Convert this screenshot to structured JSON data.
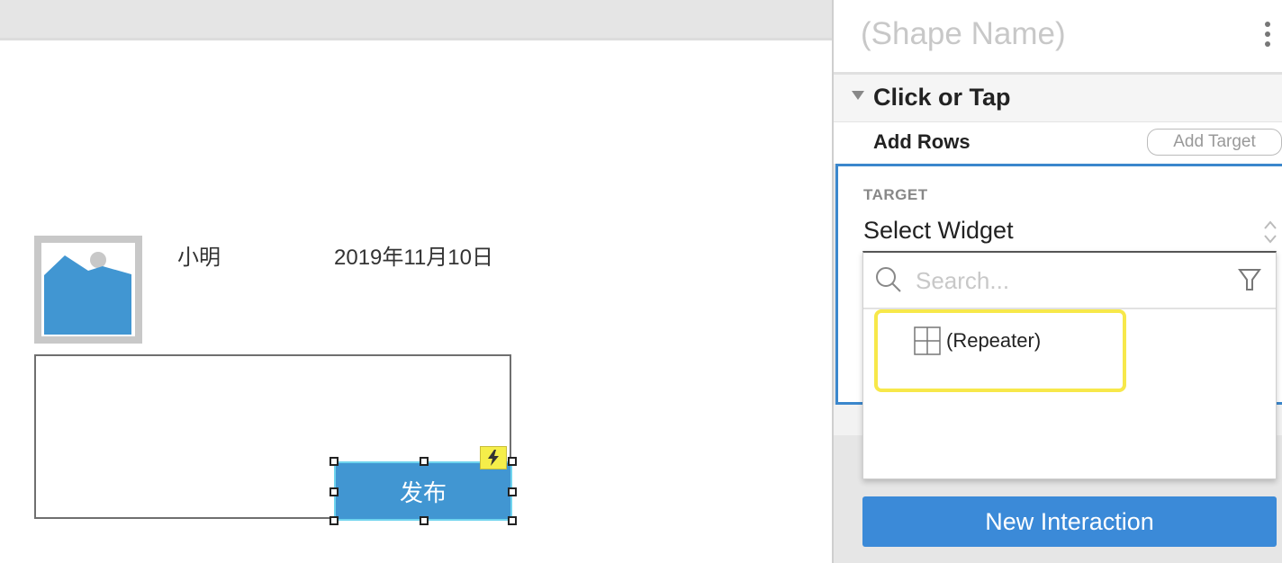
{
  "canvas": {
    "name_text": "小明",
    "date_text": "2019年11月10日",
    "publish_button_label": "发布",
    "icons": {
      "image_placeholder": "image-icon",
      "interaction_badge": "lightning-icon"
    }
  },
  "panel": {
    "shape_name_placeholder": "(Shape Name)",
    "more_icon": "kebab-menu-icon",
    "event": {
      "title": "Click or Tap",
      "collapse_icon": "triangle-down-icon"
    },
    "action": {
      "label": "Add Rows",
      "add_target_label": "Add Target"
    },
    "target": {
      "label": "TARGET",
      "select_value": "Select Widget",
      "dropdown": {
        "search_placeholder": "Search...",
        "search_value": "",
        "items": [
          {
            "label": "(Repeater)",
            "icon": "repeater-grid-icon",
            "highlighted": true
          }
        ]
      }
    },
    "new_interaction_label": "New Interaction"
  },
  "colors": {
    "accent_blue": "#3b8ad8",
    "widget_blue": "#4196d2",
    "highlight_yellow": "#f7e84a",
    "target_border": "#3b87cc"
  }
}
